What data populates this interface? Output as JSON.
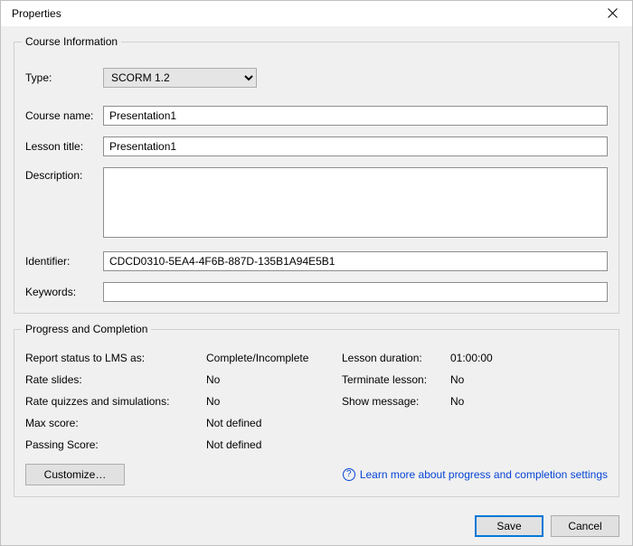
{
  "window": {
    "title": "Properties"
  },
  "course_info": {
    "legend": "Course Information",
    "type_label": "Type:",
    "type_value": "SCORM 1.2",
    "course_name_label": "Course name:",
    "course_name_value": "Presentation1",
    "lesson_title_label": "Lesson title:",
    "lesson_title_value": "Presentation1",
    "description_label": "Description:",
    "description_value": "",
    "identifier_label": "Identifier:",
    "identifier_value": "CDCD0310-5EA4-4F6B-887D-135B1A94E5B1",
    "keywords_label": "Keywords:",
    "keywords_value": ""
  },
  "progress": {
    "legend": "Progress and Completion",
    "report_status_label": "Report status to LMS as:",
    "report_status_value": "Complete/Incomplete",
    "lesson_duration_label": "Lesson duration:",
    "lesson_duration_value": "01:00:00",
    "rate_slides_label": "Rate slides:",
    "rate_slides_value": "No",
    "terminate_lesson_label": "Terminate lesson:",
    "terminate_lesson_value": "No",
    "rate_quizzes_label": "Rate quizzes and simulations:",
    "rate_quizzes_value": "No",
    "show_message_label": "Show message:",
    "show_message_value": "No",
    "max_score_label": "Max score:",
    "max_score_value": "Not defined",
    "passing_score_label": "Passing Score:",
    "passing_score_value": "Not defined",
    "customize_button": "Customize…",
    "learn_more_link": "Learn more about progress and completion settings"
  },
  "buttons": {
    "save": "Save",
    "cancel": "Cancel"
  }
}
